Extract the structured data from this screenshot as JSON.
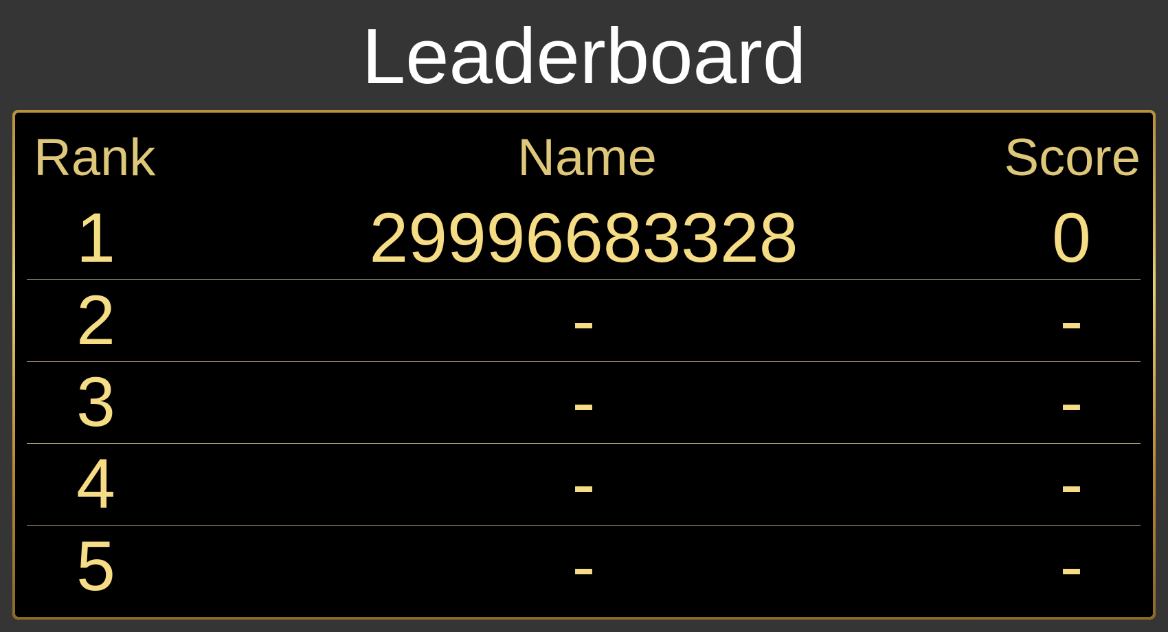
{
  "title": "Leaderboard",
  "headers": {
    "rank": "Rank",
    "name": "Name",
    "score": "Score"
  },
  "rows": [
    {
      "rank": "1",
      "name": "29996683328",
      "score": "0"
    },
    {
      "rank": "2",
      "name": "-",
      "score": "-"
    },
    {
      "rank": "3",
      "name": "-",
      "score": "-"
    },
    {
      "rank": "4",
      "name": "-",
      "score": "-"
    },
    {
      "rank": "5",
      "name": "-",
      "score": "-"
    }
  ],
  "colors": {
    "background": "#353535",
    "header_text": "#dfc77a",
    "cell_text": "#f5dc85",
    "border": "#c9a646"
  }
}
